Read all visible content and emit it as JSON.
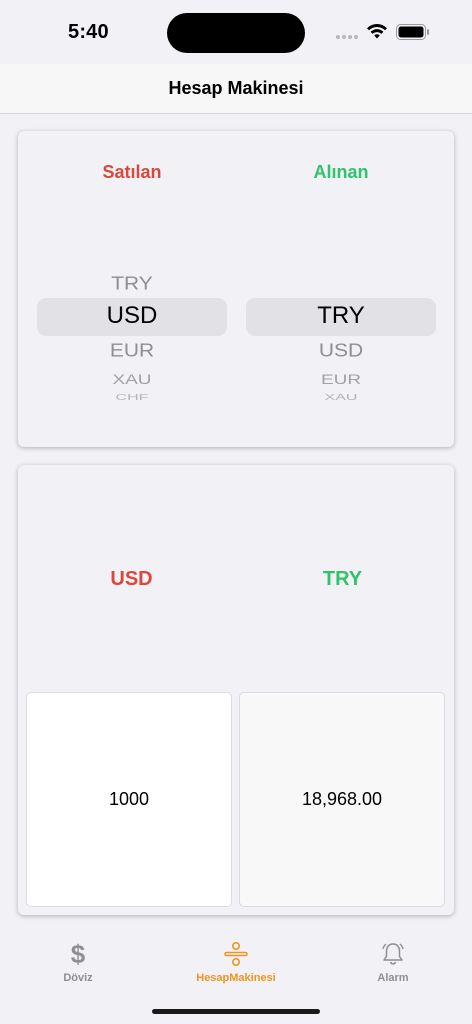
{
  "status_bar": {
    "time": "5:40"
  },
  "nav": {
    "title": "Hesap Makinesi"
  },
  "picker": {
    "sell_label": "Satılan",
    "buy_label": "Alınan",
    "sell": {
      "above": "TRY",
      "selected": "USD",
      "below": [
        "EUR",
        "XAU",
        "CHF"
      ]
    },
    "buy": {
      "above": "",
      "selected": "TRY",
      "below": [
        "USD",
        "EUR",
        "XAU"
      ]
    }
  },
  "calculator": {
    "from_currency": "USD",
    "to_currency": "TRY",
    "amount": "1000",
    "result": "18,968.00"
  },
  "tabs": [
    {
      "label": "Döviz",
      "icon": "dollar-icon",
      "active": false
    },
    {
      "label": "HesapMakinesi",
      "icon": "calculator-divide-icon",
      "active": true
    },
    {
      "label": "Alarm",
      "icon": "alarm-bell-icon",
      "active": false
    }
  ],
  "colors": {
    "sell": "#d9483b",
    "buy": "#30c46a",
    "tab_active": "#f0941f",
    "tab_inactive": "#8e8e93"
  }
}
